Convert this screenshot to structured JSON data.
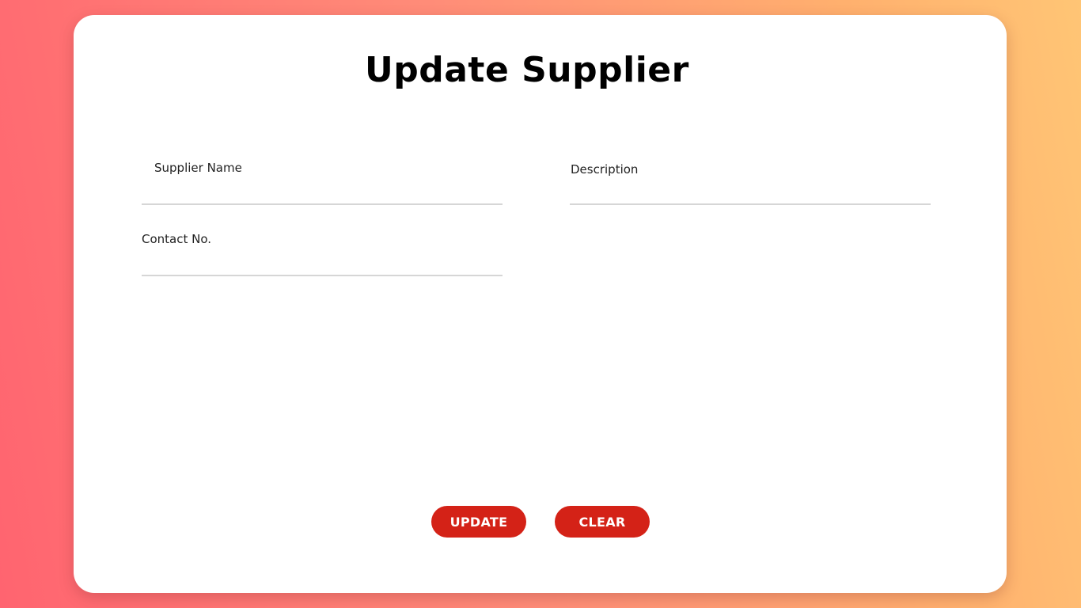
{
  "form": {
    "title": "Update Supplier",
    "fields": [
      {
        "label": "Supplier Name",
        "value": ""
      },
      {
        "label": "Description",
        "value": ""
      },
      {
        "label": "Contact No.",
        "value": ""
      }
    ],
    "buttons": {
      "update_label": "UPDATE",
      "clear_label": "CLEAR"
    }
  },
  "colors": {
    "button_bg": "#d42217",
    "background_gradient_start": "#ff6470",
    "background_gradient_end": "#ffc575",
    "card_bg": "#ffffff"
  }
}
